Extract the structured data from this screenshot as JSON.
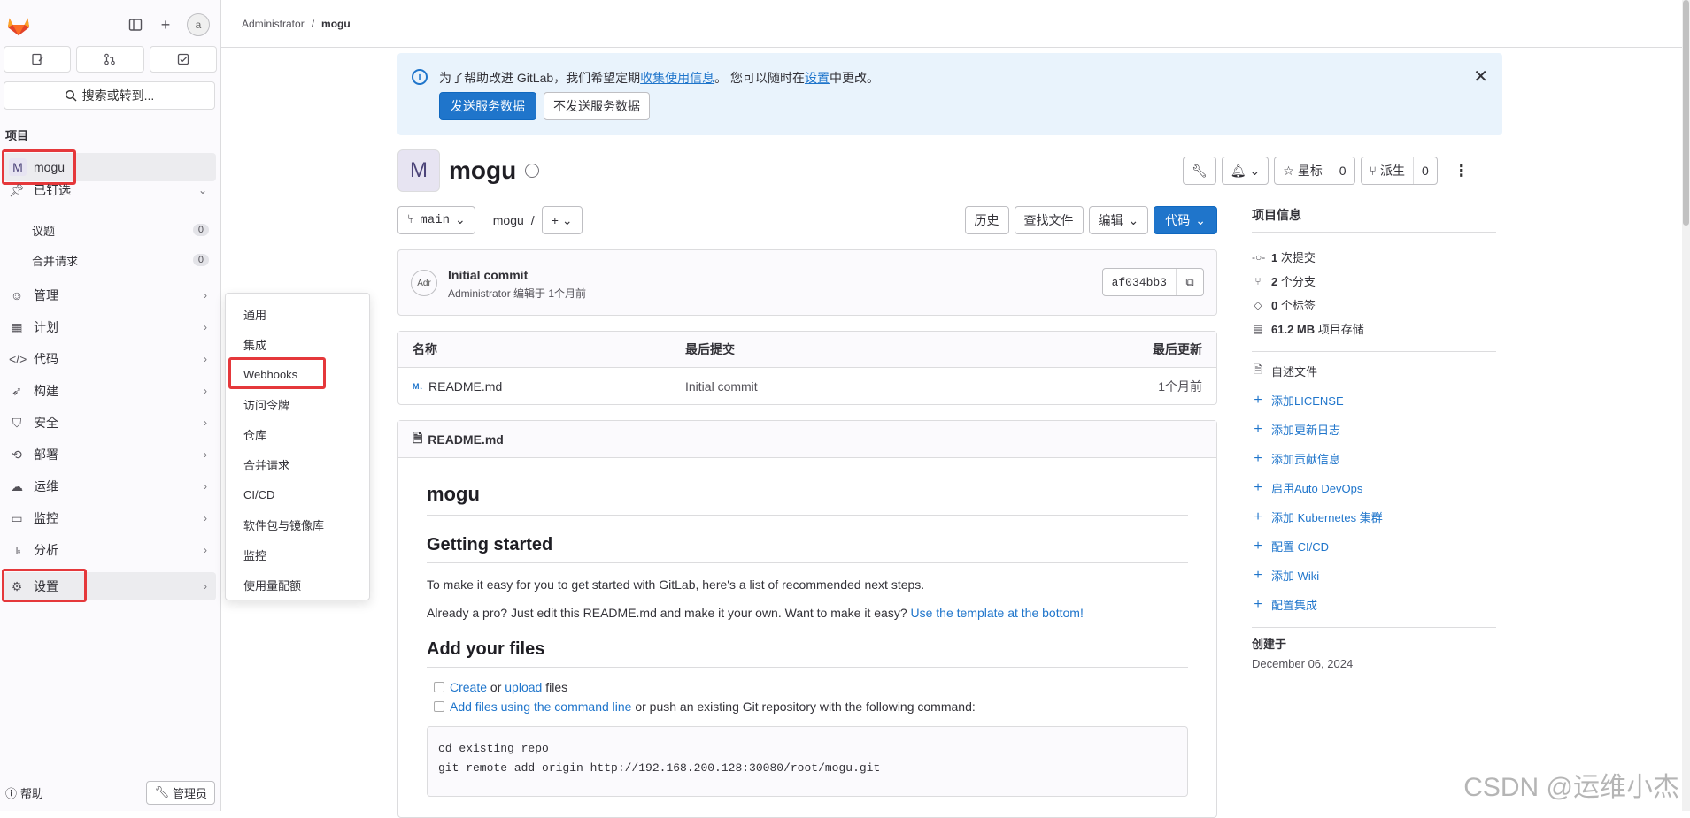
{
  "sidebar": {
    "avatar_alt": "a",
    "section_label": "项目",
    "project": {
      "initial": "M",
      "name": "mogu"
    },
    "search_label": "搜索或转到...",
    "pinned": {
      "label": "已钉选",
      "items": [
        {
          "label": "议题",
          "count": "0"
        },
        {
          "label": "合并请求",
          "count": "0"
        }
      ]
    },
    "items": [
      {
        "label": "管理",
        "icon": "users-icon"
      },
      {
        "label": "计划",
        "icon": "calendar-icon"
      },
      {
        "label": "代码",
        "icon": "code-icon"
      },
      {
        "label": "构建",
        "icon": "rocket-icon"
      },
      {
        "label": "安全",
        "icon": "shield-icon"
      },
      {
        "label": "部署",
        "icon": "deploy-icon"
      },
      {
        "label": "运维",
        "icon": "monitor-ops-icon"
      },
      {
        "label": "监控",
        "icon": "monitor-icon"
      },
      {
        "label": "分析",
        "icon": "chart-icon"
      },
      {
        "label": "设置",
        "icon": "settings-icon"
      }
    ],
    "help_label": "帮助",
    "admin_label": "管理员"
  },
  "flyout": {
    "items": [
      "通用",
      "集成",
      "Webhooks",
      "访问令牌",
      "仓库",
      "合并请求",
      "CI/CD",
      "软件包与镜像库",
      "监控",
      "使用量配额"
    ]
  },
  "breadcrumb": {
    "parent": "Administrator",
    "sep": "/",
    "current": "mogu"
  },
  "alert": {
    "text_1": "为了帮助改进 GitLab，我们希望定期",
    "link_1": "收集使用信息",
    "text_2": "。 您可以随时在",
    "link_2": "设置",
    "text_3": "中更改。",
    "primary_btn": "发送服务数据",
    "secondary_btn": "不发送服务数据"
  },
  "project": {
    "initial": "M",
    "title": "mogu",
    "star_label": "星标",
    "star_count": "0",
    "fork_label": "派生",
    "fork_count": "0"
  },
  "repo": {
    "branch": "main",
    "path": "mogu",
    "path_sep": "/",
    "history_btn": "历史",
    "find_btn": "查找文件",
    "edit_btn": "编辑",
    "code_btn": "代码"
  },
  "commit": {
    "avatar_alt": "Adr",
    "title": "Initial commit",
    "meta": "Administrator 编辑于 1个月前",
    "sha": "af034bb3"
  },
  "files": {
    "headers": [
      "名称",
      "最后提交",
      "最后更新"
    ],
    "rows": [
      {
        "name": "README.md",
        "commit": "Initial commit",
        "updated": "1个月前"
      }
    ]
  },
  "readme": {
    "filename": "README.md",
    "h1": "mogu",
    "h2_1": "Getting started",
    "p1": "To make it easy for you to get started with GitLab, here's a list of recommended next steps.",
    "p2_text": "Already a pro? Just edit this README.md and make it your own. Want to make it easy? ",
    "p2_link": "Use the template at the bottom!",
    "h2_2": "Add your files",
    "chk1_link1": "Create",
    "chk1_mid": " or ",
    "chk1_link2": "upload",
    "chk1_end": " files",
    "chk2_link": "Add files using the command line",
    "chk2_end": " or push an existing Git repository with the following command:",
    "code_1": "cd existing_repo",
    "code_2": "git remote add origin http://192.168.200.128:30080/root/mogu.git"
  },
  "info": {
    "title": "项目信息",
    "stats": [
      {
        "icon": "commit-icon",
        "value": "1",
        "label": "次提交"
      },
      {
        "icon": "branch-icon",
        "value": "2",
        "label": "个分支"
      },
      {
        "icon": "tag-icon",
        "value": "0",
        "label": "个标签"
      },
      {
        "icon": "storage-icon",
        "value": "61.2 MB",
        "label": "项目存储"
      }
    ],
    "readme_label": "自述文件",
    "links": [
      "添加LICENSE",
      "添加更新日志",
      "添加贡献信息",
      "启用Auto DevOps",
      "添加 Kubernetes 集群",
      "配置 CI/CD",
      "添加 Wiki",
      "配置集成"
    ],
    "created_label": "创建于",
    "created_value": "December 06, 2024"
  },
  "watermark": "CSDN @运维小杰",
  "colors": {
    "accent": "#1f75cb",
    "highlight": "#e5383b",
    "alert_bg": "#e9f3fc"
  }
}
